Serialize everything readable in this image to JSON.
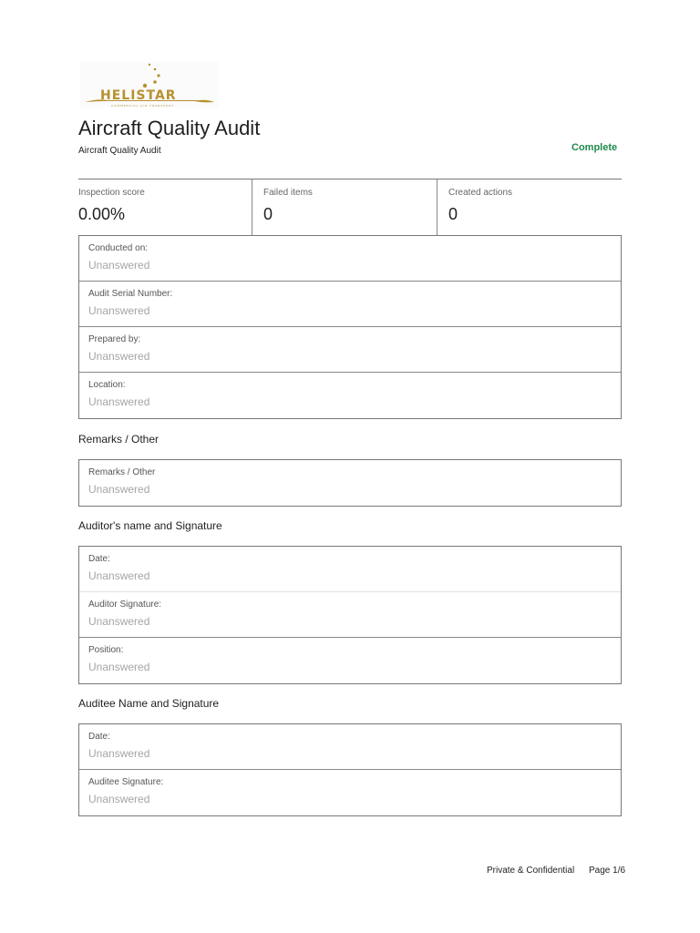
{
  "logo": {
    "name": "HELISTAR",
    "tagline": "COMMERCIAL AIR TRANSPORT",
    "color": "#b8912f"
  },
  "header": {
    "title": "Aircraft Quality Audit",
    "subtitle": "Aircraft Quality Audit",
    "status": "Complete",
    "status_color": "#1f8a4c"
  },
  "stats": [
    {
      "label": "Inspection score",
      "value": "0.00%"
    },
    {
      "label": "Failed items",
      "value": "0"
    },
    {
      "label": "Created actions",
      "value": "0"
    }
  ],
  "details": [
    {
      "label": "Conducted on:",
      "value": "Unanswered"
    },
    {
      "label": "Audit Serial Number:",
      "value": "Unanswered"
    },
    {
      "label": "Prepared by:",
      "value": "Unanswered"
    },
    {
      "label": "Location:",
      "value": "Unanswered"
    }
  ],
  "remarks": {
    "title": "Remarks / Other",
    "items": [
      {
        "label": "Remarks / Other",
        "value": "Unanswered"
      }
    ]
  },
  "auditor": {
    "title": "Auditor's name and Signature",
    "items": [
      {
        "label": "Date:",
        "value": "Unanswered"
      },
      {
        "label": "Auditor Signature:",
        "value": "Unanswered"
      },
      {
        "label": "Position:",
        "value": "Unanswered"
      }
    ]
  },
  "auditee": {
    "title": "Auditee Name and Signature",
    "items": [
      {
        "label": "Date:",
        "value": "Unanswered"
      },
      {
        "label": "Auditee Signature:",
        "value": "Unanswered"
      }
    ]
  },
  "footer": {
    "confidential": "Private & Confidential",
    "page": "Page 1/6"
  }
}
